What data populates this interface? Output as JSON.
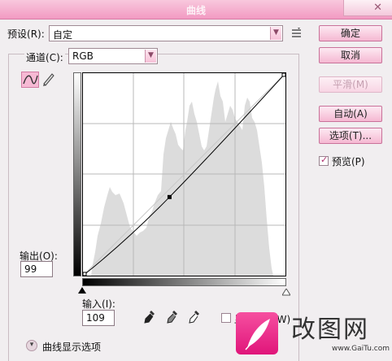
{
  "window": {
    "title": "曲线"
  },
  "preset": {
    "label": "预设",
    "key": "(R)",
    "value": "自定",
    "menu_icon": "list-menu-icon"
  },
  "channel": {
    "label": "通道",
    "key": "(C)",
    "value": "RGB"
  },
  "buttons": {
    "ok": "确定",
    "cancel": "取消",
    "smooth": "平滑(M)",
    "auto": "自动(A)",
    "options": "选项(T)..."
  },
  "preview": {
    "label": "预览(P)",
    "checked": true
  },
  "output": {
    "label": "输出",
    "key": "(O)",
    "value": "99"
  },
  "input": {
    "label": "输入",
    "key": "(I)",
    "value": "109"
  },
  "show_clipping": {
    "label": "显示修剪(W)",
    "checked": false
  },
  "curve_options": {
    "label": "曲线显示选项"
  },
  "curve_point": {
    "input": 109,
    "output": 99
  },
  "watermark": {
    "text": "改图网",
    "url": "www.GaiTu.com"
  }
}
